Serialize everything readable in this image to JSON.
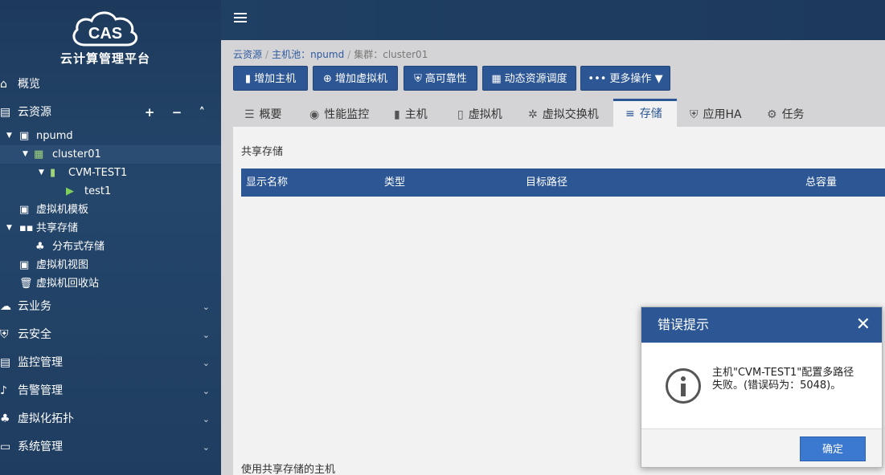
{
  "app": {
    "brand": "云计算管理平台",
    "logo_text": "CAS"
  },
  "nav": {
    "overview": "概览",
    "cloud_resources": "云资源",
    "cloud_resources_actions": "+ − ˄",
    "tree": [
      {
        "label": "npumd"
      },
      {
        "label": "cluster01"
      },
      {
        "label": "CVM-TEST1"
      },
      {
        "label": "test1"
      },
      {
        "label": "虚拟机模板"
      },
      {
        "label": "共享存储"
      },
      {
        "label": "分布式存储"
      },
      {
        "label": "虚拟机视图"
      },
      {
        "label": "虚拟机回收站"
      }
    ],
    "sections": [
      {
        "label": "云业务"
      },
      {
        "label": "云安全"
      },
      {
        "label": "监控管理"
      },
      {
        "label": "告警管理"
      },
      {
        "label": "虚拟化拓扑"
      },
      {
        "label": "系统管理"
      }
    ]
  },
  "breadcrumb": {
    "root": "云资源",
    "pool": "主机池：npumd",
    "cluster": "集群：cluster01"
  },
  "toolbar": {
    "add_host": "增加主机",
    "add_vm": "增加虚拟机",
    "ha": "高可靠性",
    "drs": "动态资源调度",
    "more": "更多操作"
  },
  "tabs": [
    {
      "label": "概要"
    },
    {
      "label": "性能监控"
    },
    {
      "label": "主机"
    },
    {
      "label": "虚拟机"
    },
    {
      "label": "虚拟交换机"
    },
    {
      "label": "存储"
    },
    {
      "label": "应用HA"
    },
    {
      "label": "任务"
    }
  ],
  "panel": {
    "shared_storage_title": "共享存储",
    "columns": [
      "显示名称",
      "类型",
      "目标路径",
      "总容量"
    ],
    "hosts_title": "使用共享存储的主机"
  },
  "dialog": {
    "title": "错误提示",
    "close": "✕",
    "message": "主机\"CVM-TEST1\"配置多路径失败。(错误码为：5048)。",
    "ok": "确定"
  }
}
